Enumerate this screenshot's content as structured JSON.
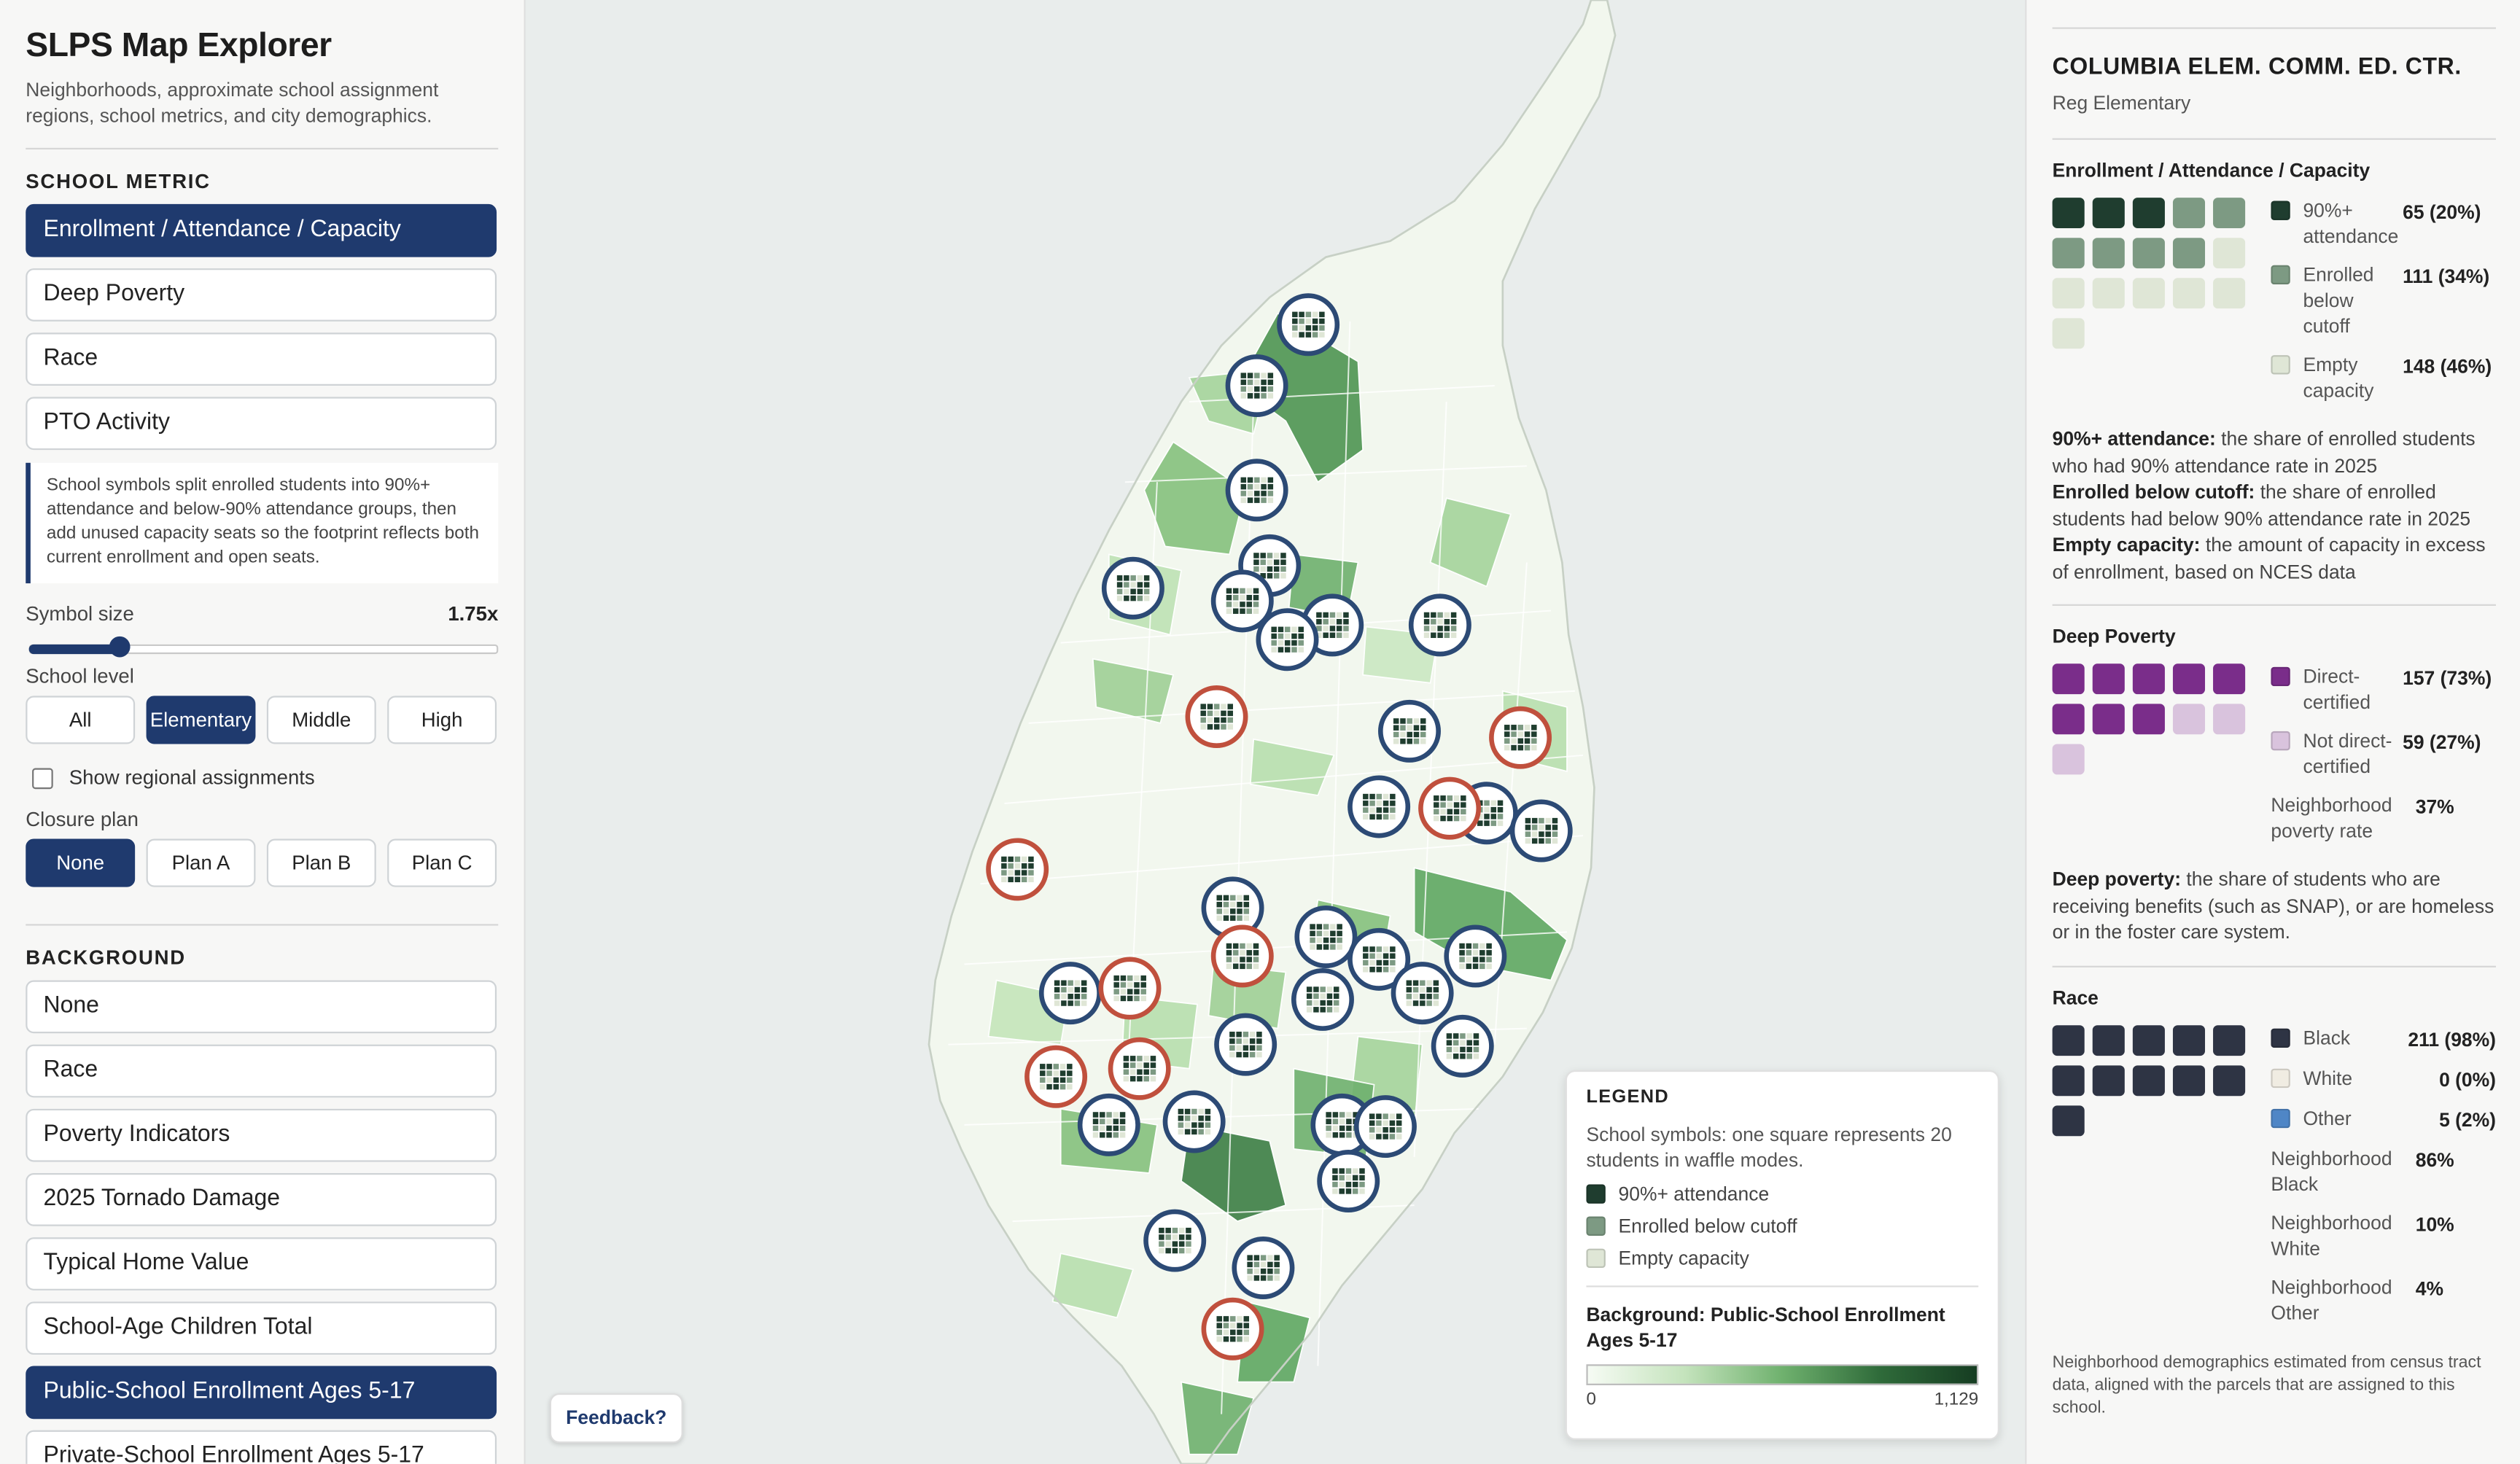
{
  "app": {
    "title": "SLPS Map Explorer",
    "subtitle": "Neighborhoods, approximate school assignment regions, school metrics, and city demographics."
  },
  "school_metric": {
    "label": "SCHOOL METRIC",
    "options": [
      "Enrollment / Attendance / Capacity",
      "Deep Poverty",
      "Race",
      "PTO Activity"
    ],
    "selected": "Enrollment / Attendance / Capacity",
    "note": "School symbols split enrolled students into 90%+ attendance and below-90% attendance groups, then add unused capacity seats so the footprint reflects both current enrollment and open seats."
  },
  "symbol_size": {
    "label": "Symbol size",
    "value": "1.75x",
    "fraction": 0.2
  },
  "school_level": {
    "label": "School level",
    "options": [
      "All",
      "Elementary",
      "Middle",
      "High"
    ],
    "selected": "Elementary"
  },
  "regional_assignments": {
    "label": "Show regional assignments",
    "checked": false
  },
  "closure_plan": {
    "label": "Closure plan",
    "options": [
      "None",
      "Plan A",
      "Plan B",
      "Plan C"
    ],
    "selected": "None"
  },
  "background": {
    "label": "BACKGROUND",
    "options": [
      "None",
      "Race",
      "Poverty Indicators",
      "2025 Tornado Damage",
      "Typical Home Value",
      "School-Age Children Total",
      "Public-School Enrollment Ages 5-17",
      "Private-School Enrollment Ages 5-17"
    ],
    "selected": "Public-School Enrollment Ages 5-17"
  },
  "feedback": {
    "label": "Feedback?"
  },
  "legend": {
    "title": "LEGEND",
    "desc": "School symbols: one square represents 20 students in waffle modes.",
    "items": [
      {
        "label": "90%+ attendance",
        "color": "#1f3d2f"
      },
      {
        "label": "Enrolled below cutoff",
        "color": "#7d9a83"
      },
      {
        "label": "Empty capacity",
        "color": "#dfe6d6"
      }
    ],
    "bg_title": "Background: Public-School Enrollment Ages 5-17",
    "min": "0",
    "max": "1,129"
  },
  "panel": {
    "school_name": "COLUMBIA ELEM. COMM. ED. CTR.",
    "school_type": "Reg Elementary",
    "enrollment": {
      "title": "Enrollment / Attendance / Capacity",
      "rows": [
        {
          "label": "90%+ attendance",
          "value": "65 (20%)",
          "color": "#1f3d2f",
          "squares": 3
        },
        {
          "label": "Enrolled below cutoff",
          "value": "111 (34%)",
          "color": "#7d9a83",
          "squares": 6
        },
        {
          "label": "Empty capacity",
          "value": "148 (46%)",
          "color": "#dfe6d6",
          "squares": 7
        }
      ],
      "notes": [
        {
          "term": "90%+ attendance:",
          "text": " the share of enrolled students who had 90% attendance rate in 2025"
        },
        {
          "term": "Enrolled below cutoff:",
          "text": " the share of enrolled students had below 90% attendance rate in 2025"
        },
        {
          "term": "Empty capacity:",
          "text": " the amount of capacity in excess of enrollment, based on NCES data"
        }
      ]
    },
    "poverty": {
      "title": "Deep Poverty",
      "rows": [
        {
          "label": "Direct-certified",
          "value": "157 (73%)",
          "color": "#7a2d8a",
          "squares": 8
        },
        {
          "label": "Not direct-certified",
          "value": "59 (27%)",
          "color": "#d9c3dd",
          "squares": 3
        }
      ],
      "extra": [
        {
          "label": "Neighborhood poverty rate",
          "value": "37%"
        }
      ],
      "note_term": "Deep poverty:",
      "note_text": " the share of students who are receiving benefits (such as SNAP), or are homeless or in the foster care system."
    },
    "race": {
      "title": "Race",
      "rows": [
        {
          "label": "Black",
          "value": "211 (98%)",
          "color": "#2e3444",
          "squares": 11
        },
        {
          "label": "White",
          "value": "0 (0%)",
          "color": "#f0ece2",
          "squares": 0
        },
        {
          "label": "Other",
          "value": "5 (2%)",
          "color": "#4f86c6",
          "squares": 0
        }
      ],
      "extra": [
        {
          "label": "Neighborhood Black",
          "value": "86%"
        },
        {
          "label": "Neighborhood White",
          "value": "10%"
        },
        {
          "label": "Neighborhood Other",
          "value": "4%"
        }
      ],
      "footnote": "Neighborhood demographics estimated from census tract data, aligned with the parcels that are assigned to this school."
    }
  },
  "colors": {
    "accent": "#1f3a6e",
    "open_school": "#2c4a75",
    "closed_school": "#c0503d"
  }
}
